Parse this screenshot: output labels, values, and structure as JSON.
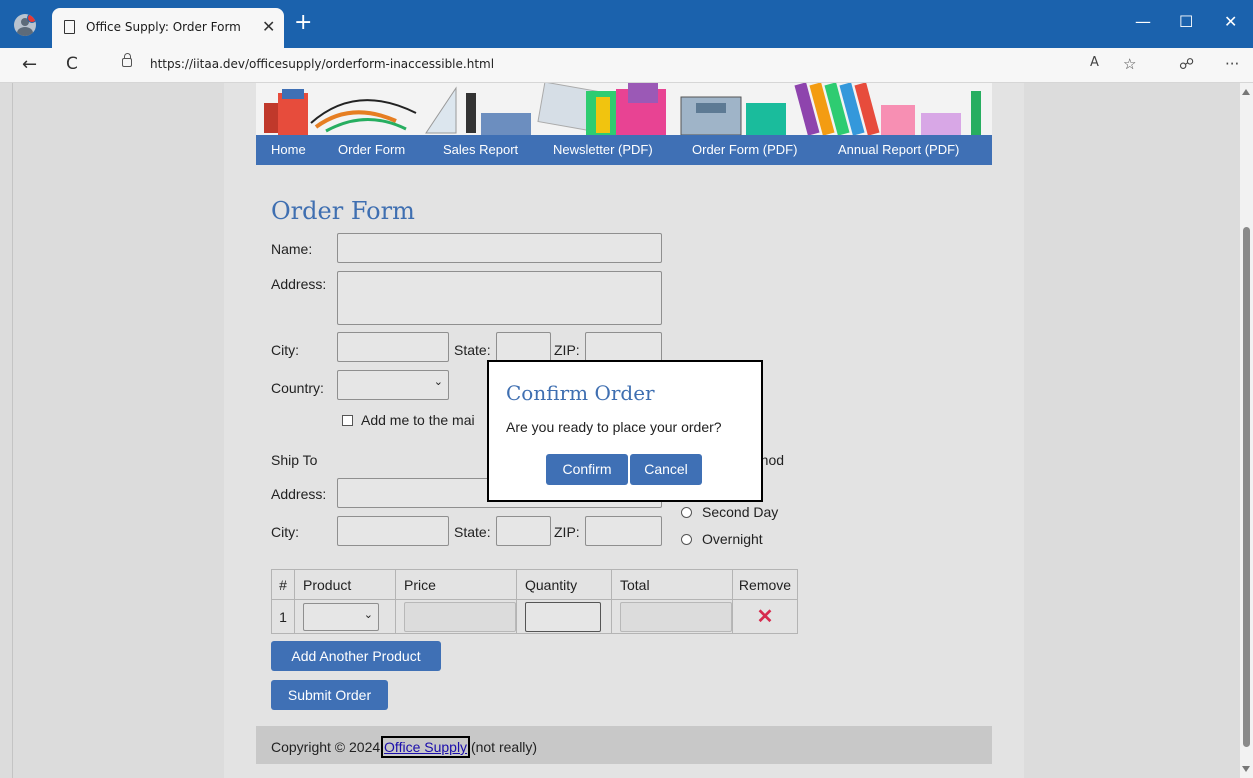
{
  "browser": {
    "tab_title": "Office Supply: Order Form",
    "url": "https://iitaa.dev/officesupply/orderform-inaccessible.html",
    "new_tab_symbol": "+",
    "tab_close_symbol": "✕",
    "minimize_symbol": "—",
    "maximize_symbol": "☐",
    "close_symbol": "✕",
    "back_symbol": "←",
    "refresh_symbol": "C",
    "read_aloud_symbol": "A",
    "favorite_symbol": "☆",
    "extensions_symbol": "☍",
    "more_symbol": "···"
  },
  "nav": {
    "items": [
      "Home",
      "Order Form",
      "Sales Report",
      "Newsletter (PDF)",
      "Order Form (PDF)",
      "Annual Report (PDF)"
    ]
  },
  "form": {
    "heading": "Order Form",
    "name_label": "Name:",
    "address_label": "Address:",
    "city_label": "City:",
    "state_label": "State:",
    "zip_label": "ZIP:",
    "country_label": "Country:",
    "mailing_list_label": "Add me to the mai",
    "ship_to_label": "Ship To",
    "ship_address_label": "Address:",
    "ship_city_label": "City:",
    "ship_state_label": "State:",
    "ship_zip_label": "ZIP:",
    "shipping_method_partial": "ethod",
    "shipping_options": [
      "Second Day",
      "Overnight"
    ],
    "select_chevron": "⌄"
  },
  "table": {
    "headers": [
      "#",
      "Product",
      "Price",
      "Quantity",
      "Total",
      "Remove"
    ],
    "row_number": "1",
    "remove_symbol": "✕"
  },
  "buttons": {
    "add_product": "Add Another Product",
    "submit": "Submit Order"
  },
  "footer": {
    "prefix": "Copyright © 2024 ",
    "link": "Office Supply",
    "suffix": " (not really)"
  },
  "modal": {
    "title": "Confirm Order",
    "message": "Are you ready to place your order?",
    "confirm": "Confirm",
    "cancel": "Cancel"
  },
  "colors": {
    "titlebar": "#1b62ad",
    "nav_blue": "#3f70b5",
    "heading_blue": "#3f6fb1",
    "remove_red": "#d62b4e"
  }
}
